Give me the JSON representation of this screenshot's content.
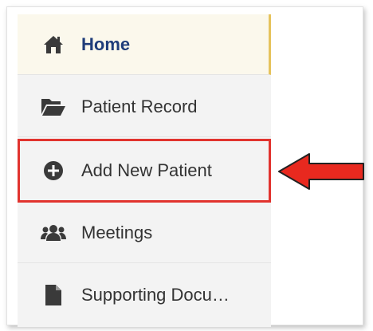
{
  "sidebar": {
    "items": [
      {
        "label": "Home",
        "icon": "home-icon"
      },
      {
        "label": "Patient Record",
        "icon": "folder-open-icon"
      },
      {
        "label": "Add New Patient",
        "icon": "plus-circle-icon"
      },
      {
        "label": "Meetings",
        "icon": "users-icon"
      },
      {
        "label": "Supporting Docu…",
        "icon": "document-icon"
      }
    ]
  },
  "colors": {
    "active_text": "#1f3d7a",
    "active_bg": "#fbf8ec",
    "active_border": "#e6c35c",
    "highlight_border": "#e1332e",
    "arrow_fill": "#e8291f",
    "icon": "#3a3a3a"
  }
}
